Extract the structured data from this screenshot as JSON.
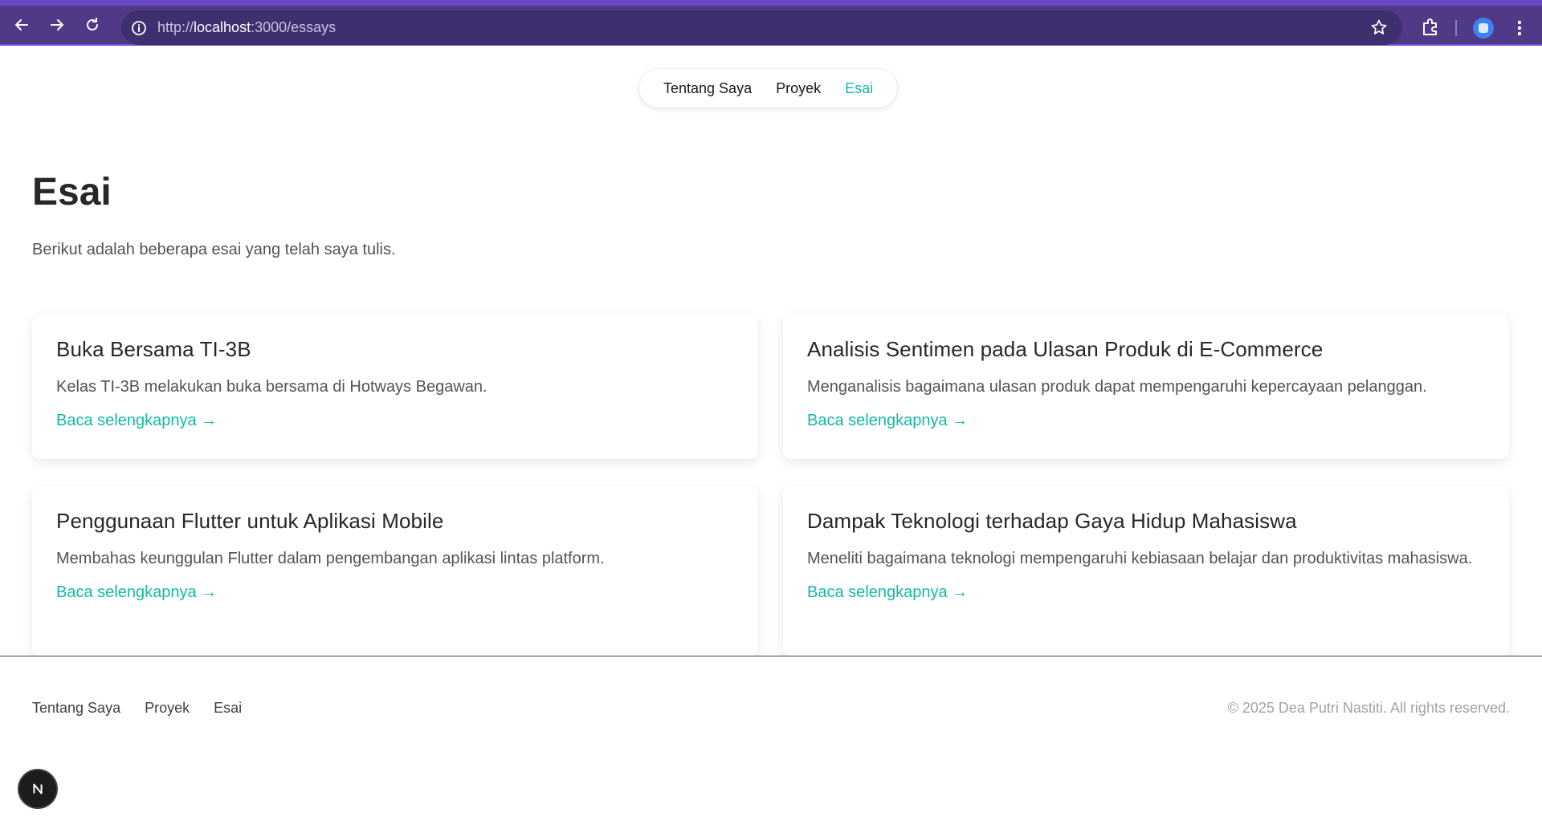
{
  "browser": {
    "url_prefix": "http://",
    "url_host": "localhost",
    "url_rest": ":3000/essays"
  },
  "nav": {
    "items": [
      {
        "label": "Tentang Saya"
      },
      {
        "label": "Proyek"
      },
      {
        "label": "Esai"
      }
    ],
    "active_color": "#14b8a6"
  },
  "header": {
    "title": "Esai",
    "intro": "Berikut adalah beberapa esai yang telah saya tulis."
  },
  "essays": [
    {
      "title": "Buka Bersama TI-3B",
      "summary": "Kelas TI-3B melakukan buka bersama di Hotways Begawan.",
      "link": "Baca selengkapnya →"
    },
    {
      "title": "Analisis Sentimen pada Ulasan Produk di E-Commerce",
      "summary": "Menganalisis bagaimana ulasan produk dapat mempengaruhi kepercayaan pelanggan.",
      "link": "Baca selengkapnya →"
    },
    {
      "title": "Penggunaan Flutter untuk Aplikasi Mobile",
      "summary": "Membahas keunggulan Flutter dalam pengembangan aplikasi lintas platform.",
      "link": "Baca selengkapnya →"
    },
    {
      "title": "Dampak Teknologi terhadap Gaya Hidup Mahasiswa",
      "summary": "Meneliti bagaimana teknologi mempengaruhi kebiasaan belajar dan produktivitas mahasiswa.",
      "link": "Baca selengkapnya →"
    }
  ],
  "footer": {
    "nav": [
      {
        "label": "Tentang Saya"
      },
      {
        "label": "Proyek"
      },
      {
        "label": "Esai"
      }
    ],
    "copyright": "© 2025 Dea Putri Nastiti. All rights reserved."
  },
  "icons": {
    "back": "arrow-left-icon",
    "forward": "arrow-right-icon",
    "reload": "reload-icon",
    "site_info": "info-icon",
    "bookmark": "star-icon",
    "extensions": "puzzle-icon",
    "menu": "more-vertical-icon",
    "dev_badge": "nextjs-logo-icon"
  }
}
